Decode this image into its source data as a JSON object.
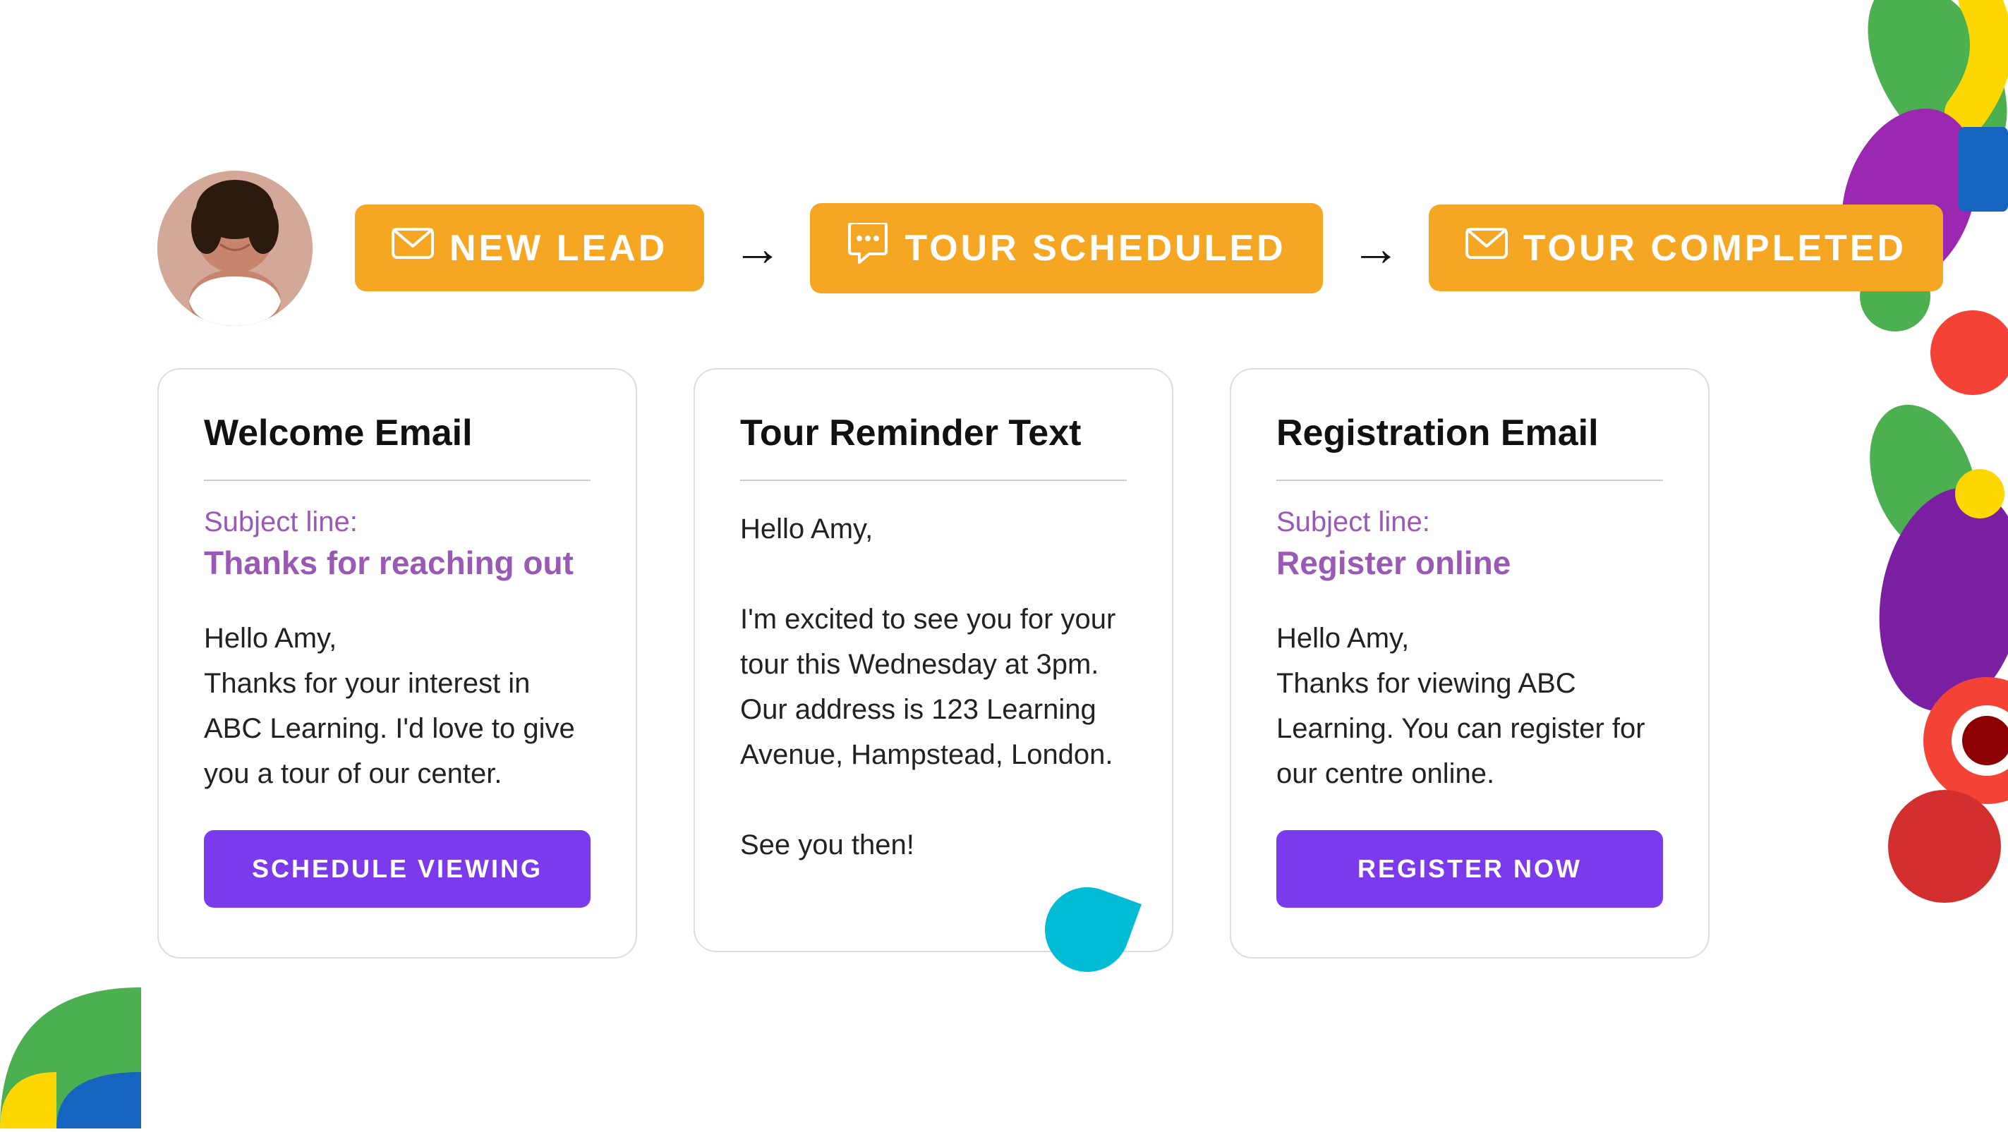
{
  "avatar": {
    "alt": "Person smiling"
  },
  "stages": [
    {
      "id": "new-lead",
      "label": "NEW LEAD",
      "icon": "✉",
      "type": "email"
    },
    {
      "id": "tour-scheduled",
      "label": "TOUR SCHEDULED",
      "icon": "💬",
      "type": "chat"
    },
    {
      "id": "tour-completed",
      "label": "TOUR COMPLETED",
      "icon": "✉",
      "type": "email"
    }
  ],
  "cards": [
    {
      "id": "welcome-email",
      "title": "Welcome Email",
      "subject_label": "Subject line:",
      "subject_value": "Thanks for reaching out",
      "body": "Hello Amy,\nThanks for your interest in ABC Learning. I'd love to give you a tour of our center.",
      "button_label": "SCHEDULE VIEWING"
    },
    {
      "id": "tour-reminder",
      "title": "Tour Reminder Text",
      "body": "Hello Amy,\n\nI'm excited to see you for your tour this Wednesday at 3pm. Our address is 123 Learning Avenue, Hampstead, London.\n\nSee you then!",
      "button_label": null
    },
    {
      "id": "registration-email",
      "title": "Registration Email",
      "subject_label": "Subject line:",
      "subject_value": "Register online",
      "body": "Hello Amy,\nThanks for viewing ABC Learning. You can register for our centre online.",
      "button_label": "REGISTER NOW"
    }
  ]
}
